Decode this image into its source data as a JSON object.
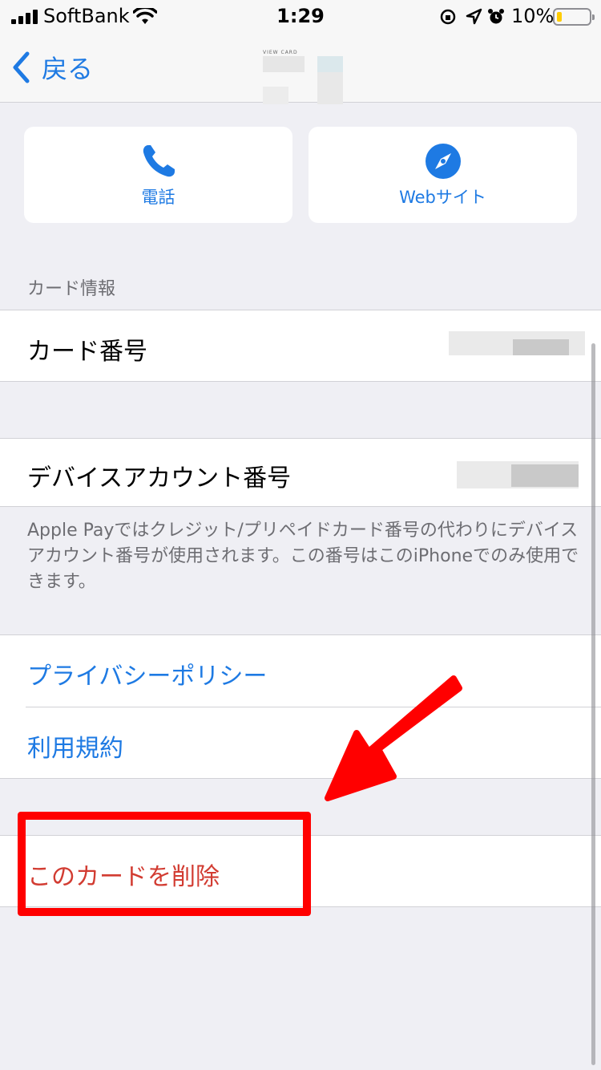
{
  "status_bar": {
    "carrier": "SoftBank",
    "time": "1:29",
    "battery_percent": "10%",
    "icons": [
      "signal-icon",
      "wifi-icon",
      "orientation-lock-icon",
      "location-icon",
      "alarm-icon",
      "battery-icon"
    ]
  },
  "nav": {
    "back_label": "戻る",
    "card_thumb_text": "VIEW CARD"
  },
  "actions": [
    {
      "label": "電話",
      "icon": "phone-icon"
    },
    {
      "label": "Webサイト",
      "icon": "compass-icon"
    }
  ],
  "card_info": {
    "section_header": "カード情報",
    "card_number_label": "カード番号",
    "device_account_label": "デバイスアカウント番号",
    "footer": "Apple Payではクレジット/プリペイドカード番号の代わりにデバイスアカウント番号が使用されます。この番号はこのiPhoneでのみ使用できます。"
  },
  "links": {
    "privacy_policy": "プライバシーポリシー",
    "terms": "利用規約"
  },
  "danger": {
    "remove_card": "このカードを削除"
  },
  "colors": {
    "accent": "#1e7ae3",
    "danger": "#d23c32",
    "annotation": "#ff0000",
    "background": "#efeff4"
  }
}
